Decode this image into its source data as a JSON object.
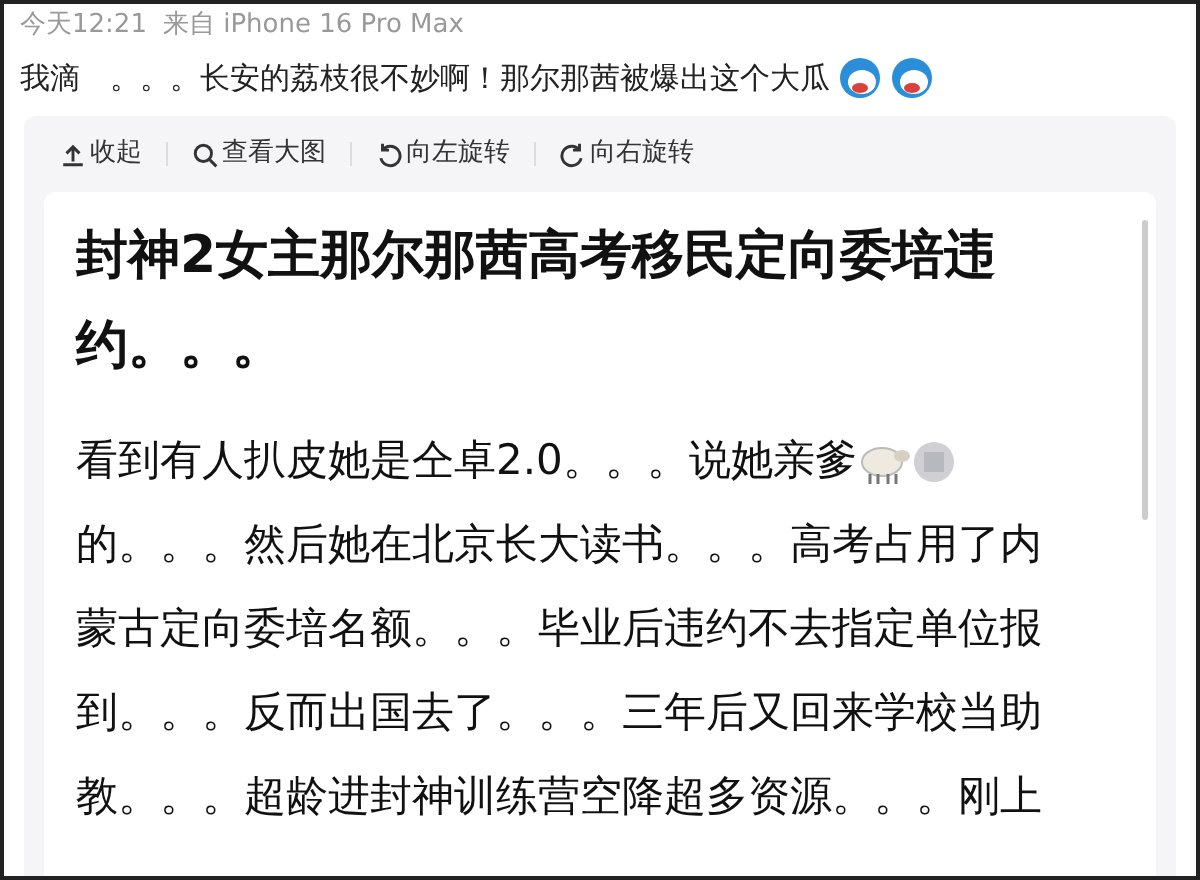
{
  "meta": {
    "time": "今天12:21",
    "source": "来自 iPhone 16 Pro Max"
  },
  "post_text": "我滴　。。。长安的荔枝很不妙啊！那尔那茜被爆出这个大瓜",
  "toolbar": [
    {
      "kind": "collapse",
      "label": "收起"
    },
    {
      "kind": "zoom",
      "label": "查看大图"
    },
    {
      "kind": "rotate_left",
      "label": "向左旋转"
    },
    {
      "kind": "rotate_right",
      "label": "向右旋转"
    }
  ],
  "image": {
    "title_lines": [
      "封神2女主那尔那茜高考移民定向委培违",
      "约。。。"
    ],
    "body_lines": [
      "看到有人扒皮她是仝卓2.0。。。说她亲爹",
      "的。。。然后她在北京长大读书。。。高考占用了内",
      "蒙古定向委培名额。。。毕业后违约不去指定单位报",
      "到。。。反而出国去了。。。三年后又回来学校当助",
      "教。。。超龄进封神训练营空降超多资源。。。刚上"
    ]
  }
}
